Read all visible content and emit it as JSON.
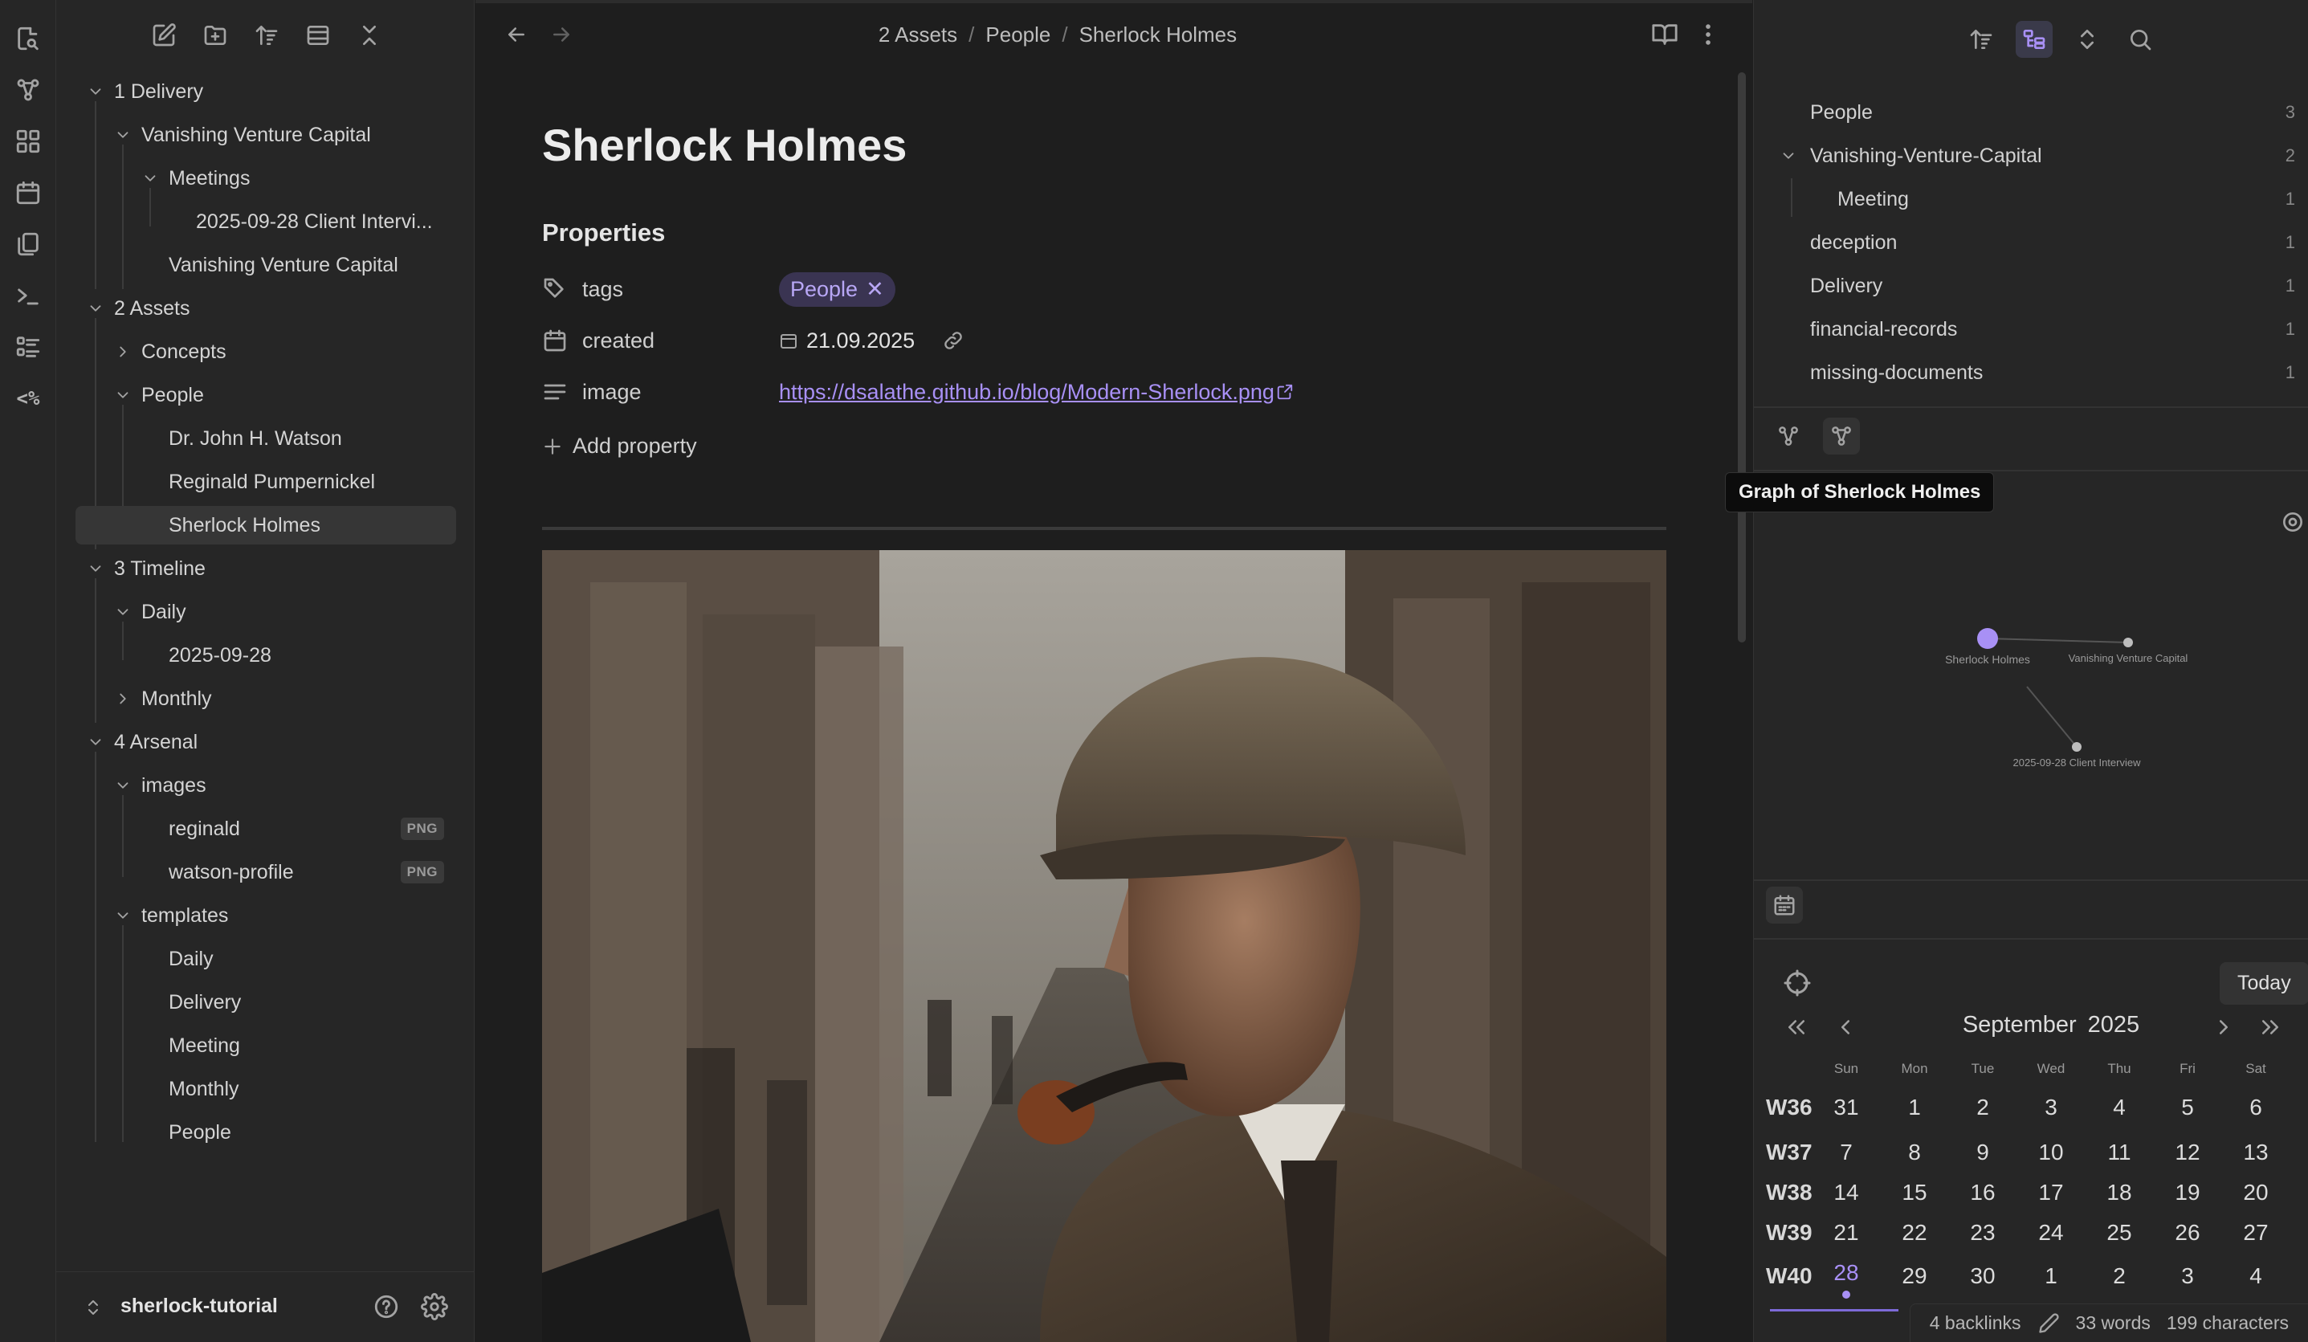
{
  "left_sidebar": {
    "tree": [
      {
        "label": "1 Delivery"
      },
      {
        "label": "Vanishing Venture Capital"
      },
      {
        "label": "Meetings"
      },
      {
        "label": "2025-09-28 Client Intervi..."
      },
      {
        "label": "Vanishing Venture Capital"
      },
      {
        "label": "2 Assets"
      },
      {
        "label": "Concepts"
      },
      {
        "label": "People"
      },
      {
        "label": "Dr. John H. Watson"
      },
      {
        "label": "Reginald Pumpernickel"
      },
      {
        "label": "Sherlock Holmes"
      },
      {
        "label": "3 Timeline"
      },
      {
        "label": "Daily"
      },
      {
        "label": "2025-09-28"
      },
      {
        "label": "Monthly"
      },
      {
        "label": "4 Arsenal"
      },
      {
        "label": "images"
      },
      {
        "label": "reginald",
        "tag": "PNG"
      },
      {
        "label": "watson-profile",
        "tag": "PNG"
      },
      {
        "label": "templates"
      },
      {
        "label": "Daily"
      },
      {
        "label": "Delivery"
      },
      {
        "label": "Meeting"
      },
      {
        "label": "Monthly"
      },
      {
        "label": "People"
      }
    ],
    "vault_name": "sherlock-tutorial"
  },
  "main": {
    "breadcrumb": [
      "2 Assets",
      "People",
      "Sherlock Holmes"
    ],
    "breadcrumb_sep": "/",
    "title": "Sherlock Holmes",
    "properties_heading": "Properties",
    "properties": {
      "tags_key": "tags",
      "tags_value": "People",
      "created_key": "created",
      "created_value": "21.09.2025",
      "image_key": "image",
      "image_value": "https://dsalathe.github.io/blog/Modern-Sherlock.png"
    },
    "add_property": "Add property"
  },
  "right_sidebar": {
    "tags": [
      {
        "name": "People",
        "count": "3"
      },
      {
        "name": "Vanishing-Venture-Capital",
        "count": "2"
      },
      {
        "name": "Meeting",
        "count": "1"
      },
      {
        "name": "deception",
        "count": "1"
      },
      {
        "name": "Delivery",
        "count": "1"
      },
      {
        "name": "financial-records",
        "count": "1"
      },
      {
        "name": "missing-documents",
        "count": "1"
      }
    ],
    "graph_tooltip": "Graph of Sherlock Holmes",
    "graph_nodes": [
      "Sherlock Holmes",
      "Vanishing Venture Capital",
      "2025-09-28 Client Interview"
    ],
    "calendar": {
      "today_label": "Today",
      "month": "September",
      "year": "2025",
      "weekdays": [
        "Sun",
        "Mon",
        "Tue",
        "Wed",
        "Thu",
        "Fri",
        "Sat"
      ],
      "weeks": [
        {
          "label": "W36",
          "days": [
            "31",
            "1",
            "2",
            "3",
            "4",
            "5",
            "6"
          ]
        },
        {
          "label": "W37",
          "days": [
            "7",
            "8",
            "9",
            "10",
            "11",
            "12",
            "13"
          ]
        },
        {
          "label": "W38",
          "days": [
            "14",
            "15",
            "16",
            "17",
            "18",
            "19",
            "20"
          ]
        },
        {
          "label": "W39",
          "days": [
            "21",
            "22",
            "23",
            "24",
            "25",
            "26",
            "27"
          ]
        },
        {
          "label": "W40",
          "days": [
            "28",
            "29",
            "30",
            "1",
            "2",
            "3",
            "4"
          ]
        }
      ],
      "today": "28"
    }
  },
  "status_bar": {
    "backlinks": "4 backlinks",
    "words": "33 words",
    "characters": "199 characters"
  },
  "colors": {
    "accent": "#a890f5",
    "background": "#1e1e1e",
    "sidebar": "#262626"
  }
}
